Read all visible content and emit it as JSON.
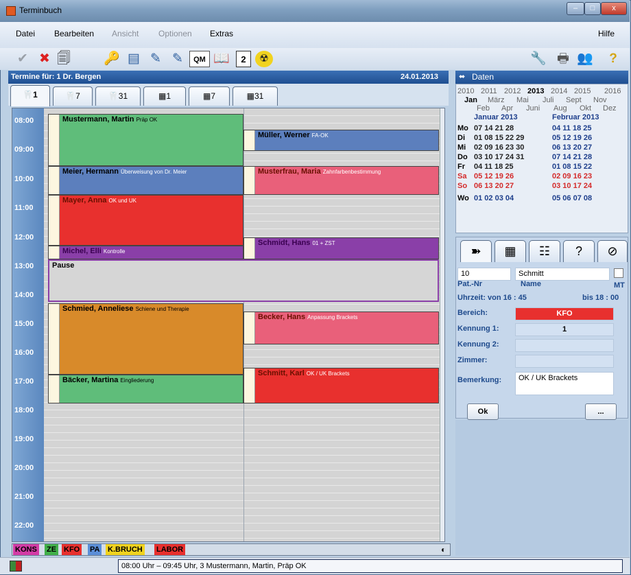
{
  "window": {
    "title": "Terminbuch",
    "buttons": [
      "–",
      "□",
      "x"
    ]
  },
  "menu": {
    "datei": "Datei",
    "bearbeiten": "Bearbeiten",
    "ansicht": "Ansicht",
    "optionen": "Optionen",
    "extras": "Extras",
    "hilfe": "Hilfe"
  },
  "toolbar": {
    "icons": [
      "check-icon",
      "delete-icon",
      "print-preview-icon",
      "key-icon",
      "card-icon",
      "edit-icon",
      "edit2-icon",
      "qm-icon",
      "book-icon",
      "number-icon",
      "radiation-icon",
      "tools-icon",
      "printer-icon",
      "group-icon",
      "help-icon"
    ],
    "num_label": "2",
    "qm_label": "QM",
    "help_label": "?"
  },
  "main": {
    "header_left": "Termine für: 1 Dr. Bergen",
    "header_date": "24.01.2013",
    "tabs": [
      "1",
      "7",
      "31",
      "1",
      "7",
      "31"
    ]
  },
  "times": [
    "08:00",
    "09:00",
    "10:00",
    "11:00",
    "12:00",
    "13:00",
    "14:00",
    "15:00",
    "16:00",
    "17:00",
    "18:00",
    "19:00",
    "20:00",
    "21:00",
    "22:00"
  ],
  "appointments": [
    {
      "name": "Mustermann, Martin",
      "note": "Präp OK",
      "color": "#5fbd7a"
    },
    {
      "name": "Müller, Werner",
      "note": "FA-OK",
      "color": "#5c7fbd"
    },
    {
      "name": "Meier, Hermann",
      "note": "Überweisung von Dr. Meier",
      "color": "#5c7fbd"
    },
    {
      "name": "Musterfrau, Maria",
      "note": "Zahnfarbenbestimmung",
      "color": "#e9607a"
    },
    {
      "name": "Mayer, Anna",
      "note": "OK und UK",
      "color": "#e8302e"
    },
    {
      "name": "Schmidt, Hans",
      "note": "01 + ZST",
      "color": "#8a3fa8"
    },
    {
      "name": "Michel, Elli",
      "note": "Kontrolle",
      "color": "#8a3fa8"
    },
    {
      "name": "Pause",
      "note": "",
      "color": "#d6d6d6"
    },
    {
      "name": "Schmied, Anneliese",
      "note": "Schiene und Therapie",
      "color": "#d88a2a"
    },
    {
      "name": "Becker, Hans",
      "note": "Anpassung Brackets",
      "color": "#e9607a"
    },
    {
      "name": "Schmitt, Karl",
      "note": "OK / UK Brackets",
      "color": "#e8302e"
    },
    {
      "name": "Bäcker, Martina",
      "note": "Eingliederung",
      "color": "#5fbd7a"
    }
  ],
  "legend": [
    {
      "label": "KONS",
      "color": "#d33ca6"
    },
    {
      "label": "ZE",
      "color": "#41b04a"
    },
    {
      "label": "KFO",
      "color": "#e8302e"
    },
    {
      "label": "PA",
      "color": "#5b8fd8"
    },
    {
      "label": "K.BRUCH",
      "color": "#f1d31f"
    },
    {
      "label": "LABOR",
      "color": "#e8302e"
    }
  ],
  "status": {
    "message": "08:00 Uhr – 09:45 Uhr, 3  Mustermann, Martin,  Präp OK"
  },
  "daten": {
    "title": "Daten",
    "years": [
      "2010",
      "2011",
      "2012",
      "2013",
      "2014",
      "2015",
      "2016"
    ],
    "months1": [
      "Jan",
      "März",
      "Mai",
      "Juli",
      "Sept",
      "Nov"
    ],
    "months2": [
      "Feb",
      "Apr",
      "Juni",
      "Aug",
      "Okt",
      "Dez"
    ],
    "jan_title": "Januar 2013",
    "feb_title": "Februar 2013",
    "rows": [
      {
        "d": "Mo",
        "j": "07 14 21 28",
        "f": "04 11 18 25"
      },
      {
        "d": "Di",
        "j": "01 08 15 22 29",
        "f": "05 12 19 26"
      },
      {
        "d": "Mi",
        "j": "02 09 16 23 30",
        "f": "06 13 20 27"
      },
      {
        "d": "Do",
        "j": "03 10 17 24 31",
        "f": "07 14 21 28"
      },
      {
        "d": "Fr",
        "j": "04 11 18 25",
        "f": "01 08 15 22"
      },
      {
        "d": "Sa",
        "j": "05 12 19 26",
        "f": "02 09 16 23"
      },
      {
        "d": "So",
        "j": "06 13 20 27",
        "f": "03 10 17 24"
      },
      {
        "d": "Wo",
        "j": "01 02 03 04",
        "f": "05 06 07 08"
      }
    ]
  },
  "detail": {
    "pat_nr": "10",
    "name": "Schmitt",
    "pat_nr_label": "Pat.-Nr",
    "name_label": "Name",
    "mt_label": "MT",
    "uhrzeit": "Uhrzeit:  von 16 : 45",
    "bis": "bis 18 : 00",
    "bereich_label": "Bereich:",
    "bereich": "KFO",
    "kennung1_label": "Kennung 1:",
    "kennung1": "1",
    "kennung2_label": "Kennung 2:",
    "kennung2": "",
    "zimmer_label": "Zimmer:",
    "zimmer": "",
    "bemerkung_label": "Bemerkung:",
    "bemerkung": "OK / UK Brackets",
    "ok_label": "Ok",
    "more_label": "..."
  }
}
